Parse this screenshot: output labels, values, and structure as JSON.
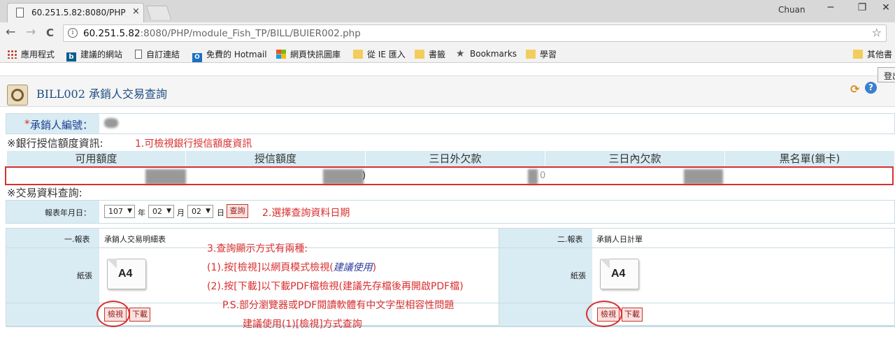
{
  "browser": {
    "tab_title": "60.251.5.82:8080/PHP/(",
    "tab_close": "×",
    "profile_name": "Chuan",
    "min_glyph": "─",
    "max_glyph": "❐",
    "close_glyph": "✕",
    "back_glyph": "←",
    "forward_glyph": "→",
    "reload_glyph": "C",
    "info_glyph": "i",
    "url_host": "60.251.5.82",
    "url_rest": ":8080/PHP/module_Fish_TP/BILL/BUIER002.php",
    "star_glyph": "☆",
    "bookmarks": [
      {
        "label": "應用程式",
        "icon": "apps-icon"
      },
      {
        "label": "建議的網站",
        "icon": "bing-icon"
      },
      {
        "label": "自訂連結",
        "icon": "page-icon"
      },
      {
        "label": "免費的 Hotmail",
        "icon": "outlook-icon"
      },
      {
        "label": "網頁快訊圖庫",
        "icon": "windows-icon"
      },
      {
        "label": "從 IE 匯入",
        "icon": "folder-icon"
      },
      {
        "label": "書籤",
        "icon": "folder-icon"
      },
      {
        "label": "Bookmarks",
        "icon": "star-icon"
      },
      {
        "label": "學習",
        "icon": "folder-icon"
      },
      {
        "label": "其他書",
        "icon": "folder-icon"
      }
    ],
    "bing_glyph": "b",
    "outlook_glyph": "O",
    "bm_star_glyph": "★"
  },
  "page": {
    "login_label": "登出",
    "title": "BILL002 承銷人交易查詢",
    "refresh_glyph": "⟳",
    "help_glyph": "?",
    "underwriter_label_star": "*",
    "underwriter_label": "承銷人編號：",
    "bank_section_title": "※銀行授信額度資訊:",
    "note1": "1.可檢視銀行授信額度資訊",
    "bank_headers": [
      "可用額度",
      "授信額度",
      "三日外欠款",
      "三日內欠款",
      "黑名單(鎖卡)"
    ],
    "bank_values": [
      "",
      ")",
      "0",
      ""
    ],
    "tx_section_title": "※交易資料查詢:",
    "report_date_label": "報表年月日：",
    "year": "107",
    "year_unit": "年",
    "month": "02",
    "month_unit": "月",
    "day": "02",
    "day_unit": "日",
    "dropdown_arrow": "▼",
    "query_button": "查詢",
    "note2": "2.選擇查詢資料日期",
    "report1_no": "一.報表",
    "report1_name": "承銷人交易明細表",
    "report2_no": "二.報表",
    "report2_name": "承銷人日計單",
    "paper_label": "紙張",
    "a4_text": "A4",
    "view_button": "檢視",
    "download_button": "下載",
    "note3_title": "3.查詢顯示方式有兩種:",
    "note3_line1_pre": "(1).按[檢視]以網頁模式檢視(",
    "note3_line1_em": "建議使用",
    "note3_line1_post": ")",
    "note3_line2": "(2).按[下載]以下載PDF檔檢視(建議先存檔後再開啟PDF檔)",
    "note3_line3": "P.S.部分瀏覽器或PDF閱讀軟體有中文字型相容性問題",
    "note3_line4": "建議使用(1)[檢視]方式查詢"
  },
  "colors": {
    "annotation_red": "#d92f2f",
    "label_blue_bg": "#d9ebf3",
    "title_blue": "#1c4d82",
    "emphasis_blue": "#2e3d9e"
  }
}
